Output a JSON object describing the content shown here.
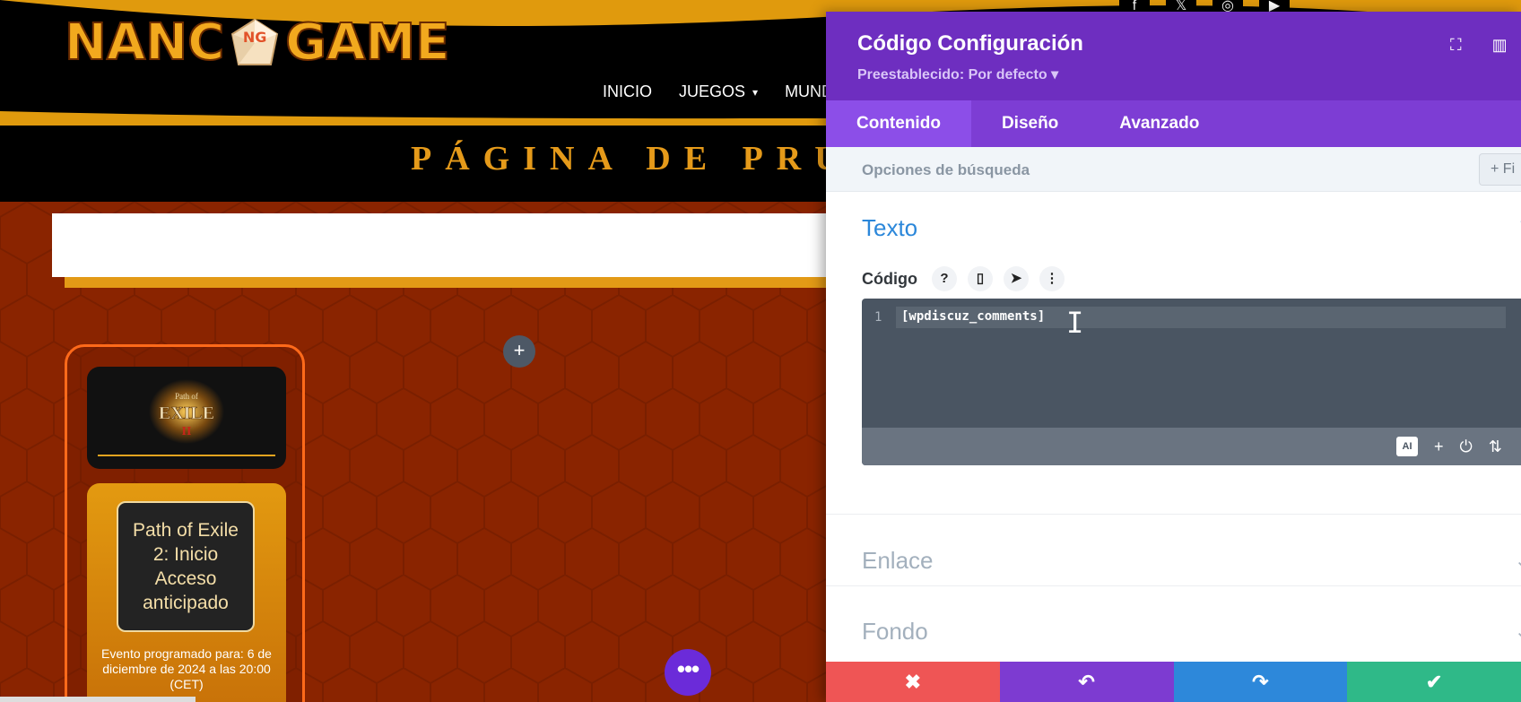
{
  "site": {
    "logo_left": "NANC",
    "logo_badge": "NG",
    "logo_right": "GAME",
    "nav": [
      {
        "label": "INICIO"
      },
      {
        "label": "JUEGOS",
        "chevron": "⌄"
      },
      {
        "label": "MUND"
      }
    ],
    "page_title": "PÁGINA DE PRU",
    "social_icons": [
      "facebook-icon",
      "x-icon",
      "instagram-icon",
      "youtube-icon"
    ]
  },
  "card": {
    "image_text": "EXILE",
    "image_text_top": "Path of",
    "title": "Path of Exile 2: Inicio Acceso anticipado",
    "event": "Evento programado para: 6 de diciembre de 2024 a las 20:00 (CET)"
  },
  "builder": {
    "add_glyph": "+",
    "fab_glyph": "•••"
  },
  "panel": {
    "title": "Código Configuración",
    "preset": "Preestablecido: Por defecto ▾",
    "tabs": [
      {
        "label": "Contenido",
        "active": true
      },
      {
        "label": "Diseño",
        "active": false
      },
      {
        "label": "Avanzado",
        "active": false
      }
    ],
    "search_label": "Opciones de búsqueda",
    "filter_label": "+ Fi",
    "section_texto": "Texto",
    "codigo_label": "Código",
    "editor": {
      "line_number": "1",
      "code": "[wpdiscuz_comments]",
      "ai_label": "AI"
    },
    "section_enlace": "Enlace",
    "section_fondo": "Fondo"
  },
  "colors": {
    "panel_purple": "#6e2ec0",
    "tab_active": "#8c4ee8",
    "accent_blue": "#2b87da",
    "cancel_red": "#ef5555",
    "save_green": "#2fb988",
    "brand_orange": "#f2a91e"
  }
}
